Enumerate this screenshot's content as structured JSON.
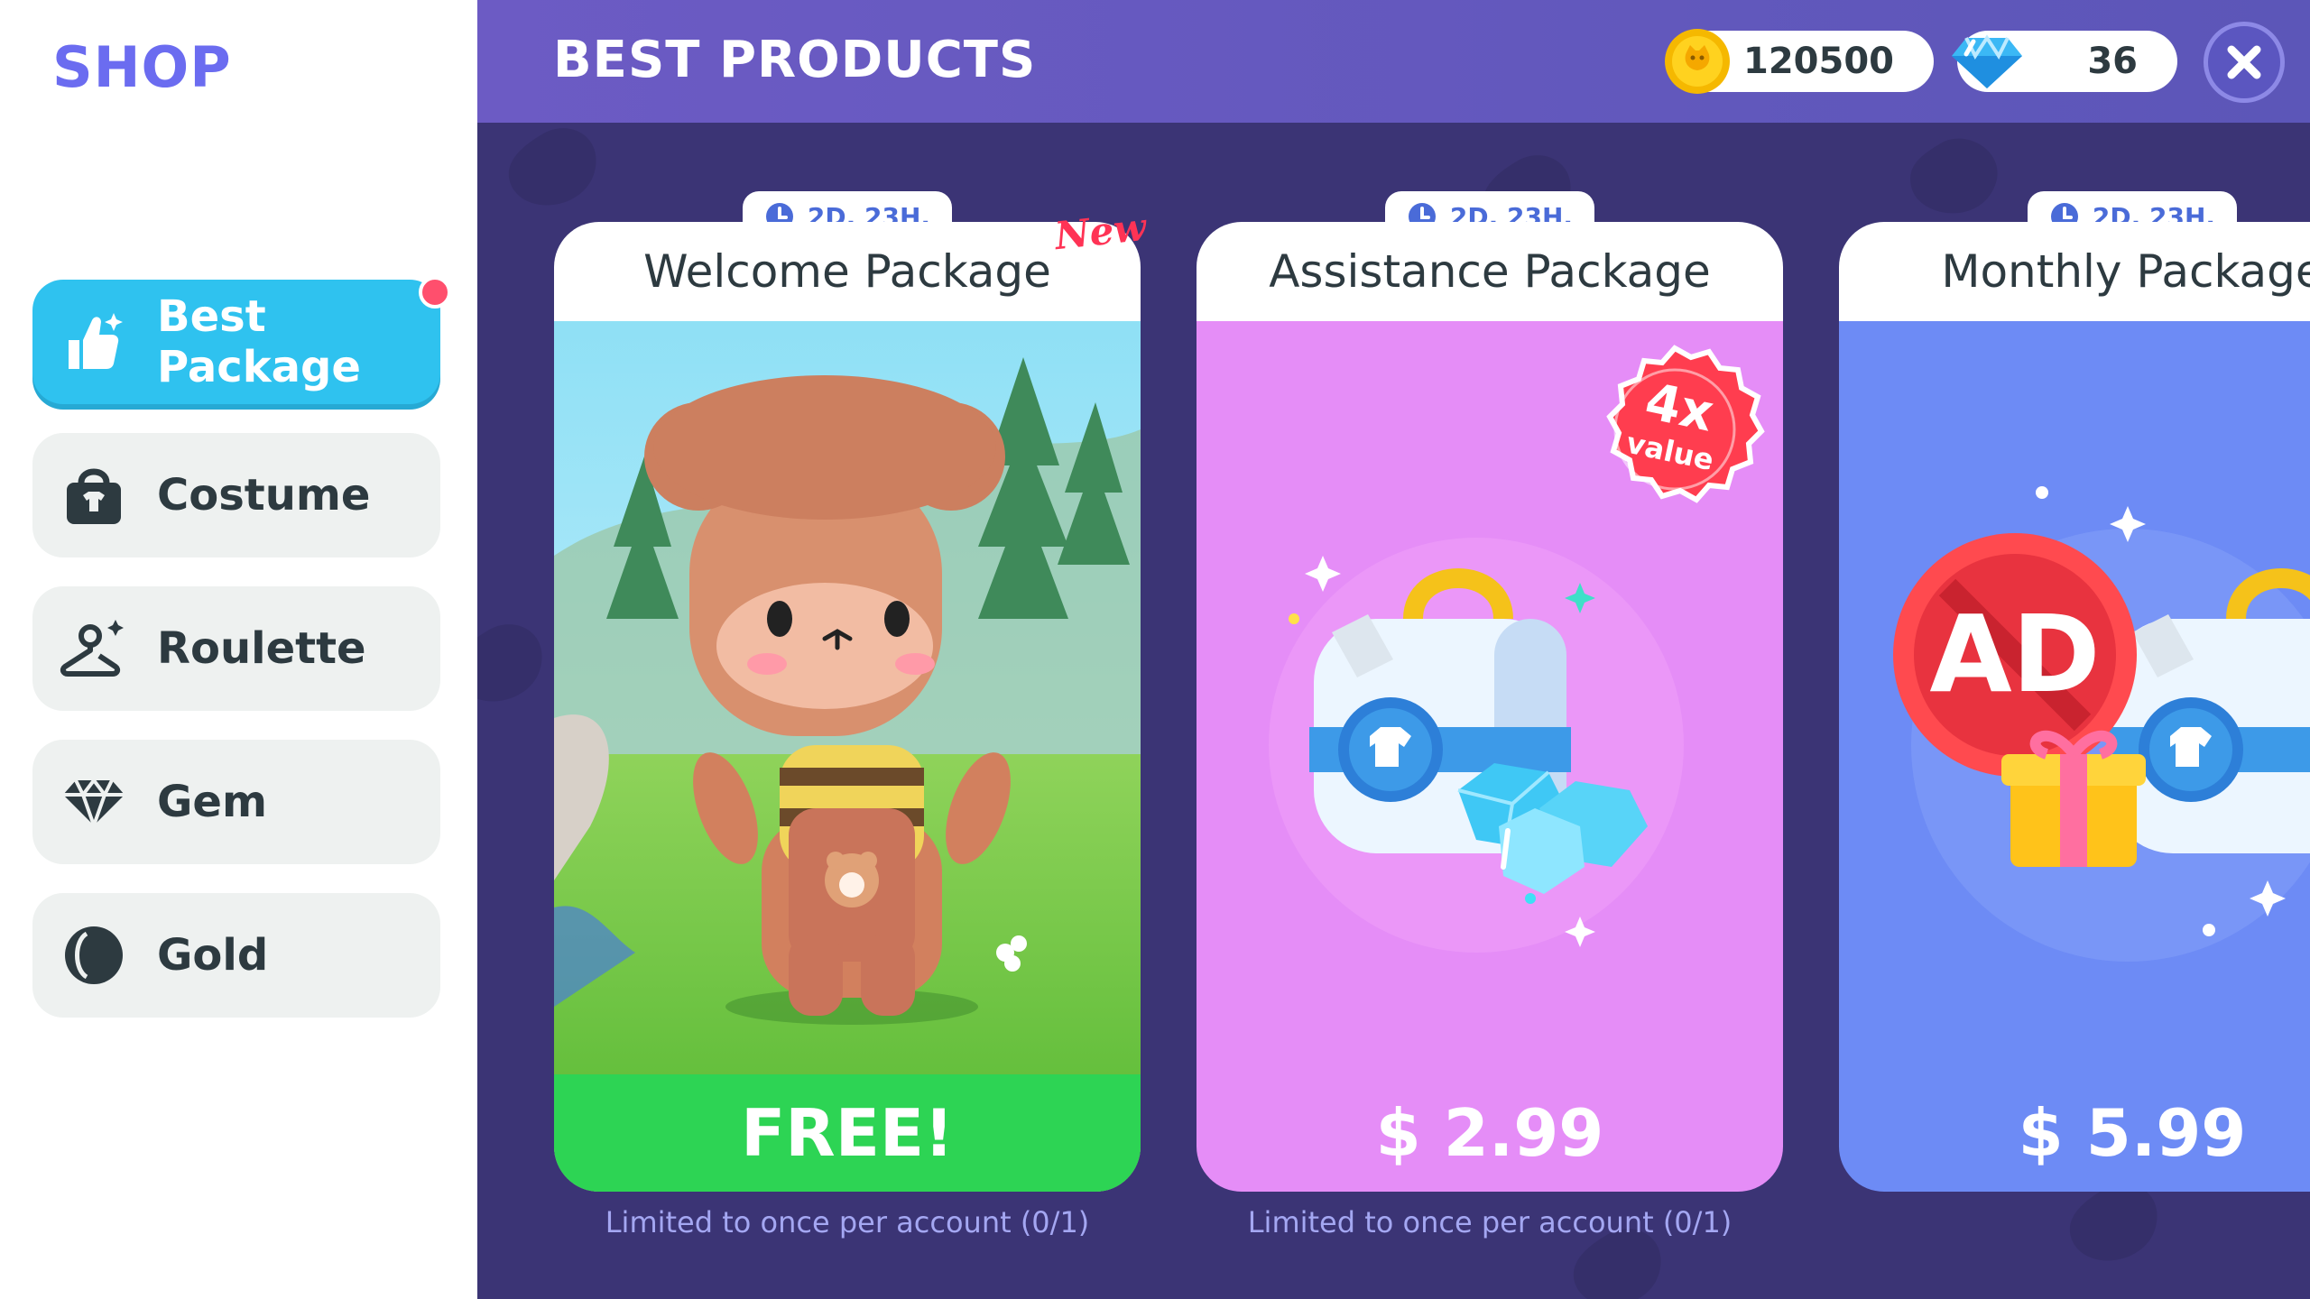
{
  "sidebar": {
    "title": "SHOP",
    "items": [
      {
        "label": "Best Package",
        "icon": "thumbs-up-icon",
        "active": true
      },
      {
        "label": "Costume",
        "icon": "bag-icon",
        "active": false
      },
      {
        "label": "Roulette",
        "icon": "hanger-icon",
        "active": false
      },
      {
        "label": "Gem",
        "icon": "gem-icon",
        "active": false
      },
      {
        "label": "Gold",
        "icon": "gold-coin-icon",
        "active": false
      }
    ]
  },
  "header": {
    "title": "BEST PRODUCTS",
    "gold": "120500",
    "gems": "36"
  },
  "cards": [
    {
      "timer": "2D. 23H.",
      "title": "Welcome Package",
      "badge": "New",
      "price": "FREE!",
      "limit": "Limited to once per account (0/1)"
    },
    {
      "timer": "2D. 23H.",
      "title": "Assistance Package",
      "ribbon_top": "4x",
      "ribbon_bottom": "value",
      "price": "$ 2.99",
      "limit": "Limited to once per account (0/1)"
    },
    {
      "timer": "2D. 23H.",
      "title": "Monthly Package",
      "ad_label": "AD",
      "price": "$ 5.99"
    }
  ],
  "colors": {
    "accent": "#2fc2ef",
    "header_bg": "#5c56b8",
    "main_bg": "#3b3475",
    "free_green": "#2dd454",
    "assistance_pink": "#e58df7",
    "monthly_blue": "#6d8bf5"
  }
}
